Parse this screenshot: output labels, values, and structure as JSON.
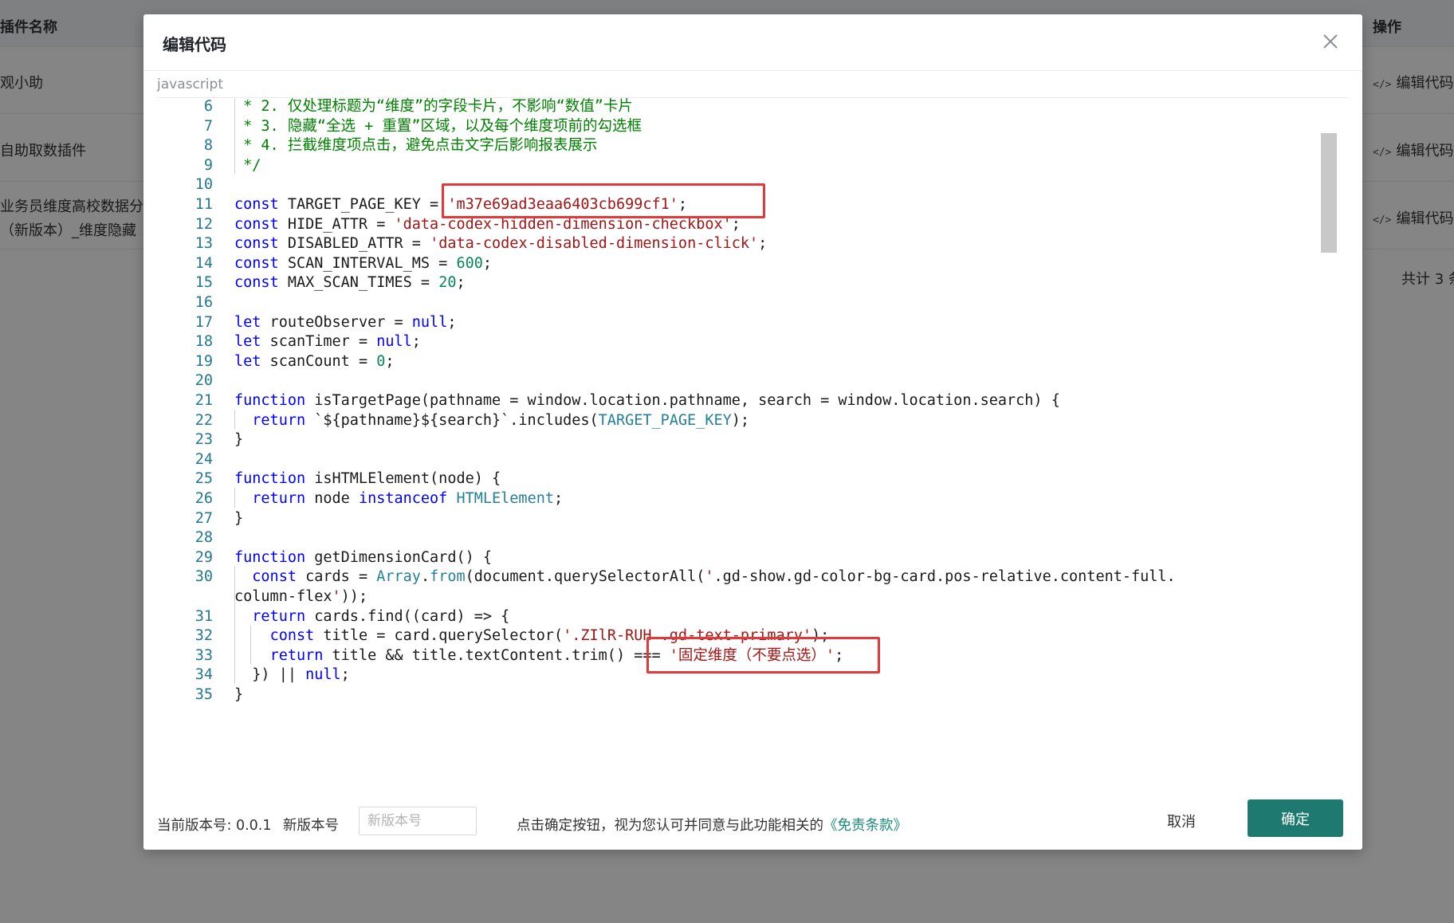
{
  "background": {
    "table_headers": {
      "name": "插件名称",
      "actions": "操作"
    },
    "rows": [
      {
        "name_line1": "观小助",
        "name_line2": "",
        "action": "编辑代码"
      },
      {
        "name_line1": "自助取数插件",
        "name_line2": "",
        "action": "编辑代码"
      },
      {
        "name_line1": "业务员维度高校数据分析",
        "name_line2": "（新版本）_维度隐藏",
        "action": "编辑代码"
      }
    ],
    "total_text": "共计 3 条",
    "action_icon_glyph": "</>"
  },
  "modal": {
    "title": "编辑代码",
    "language": "javascript",
    "close_icon": "close-icon"
  },
  "code_lines": [
    {
      "n": "6",
      "text": " * 2. 仅处理标题为“维度”的字段卡片，不影响“数值”卡片"
    },
    {
      "n": "7",
      "text": " * 3. 隐藏“全选 + 重置”区域，以及每个维度项前的勾选框"
    },
    {
      "n": "8",
      "text": " * 4. 拦截维度项点击，避免点击文字后影响报表展示"
    },
    {
      "n": "9",
      "text": " */"
    },
    {
      "n": "10",
      "text": ""
    },
    {
      "n": "11",
      "text": "const TARGET_PAGE_KEY = 'm37e69ad3eaa6403cb699cf1';"
    },
    {
      "n": "12",
      "text": "const HIDE_ATTR = 'data-codex-hidden-dimension-checkbox';"
    },
    {
      "n": "13",
      "text": "const DISABLED_ATTR = 'data-codex-disabled-dimension-click';"
    },
    {
      "n": "14",
      "text": "const SCAN_INTERVAL_MS = 600;"
    },
    {
      "n": "15",
      "text": "const MAX_SCAN_TIMES = 20;"
    },
    {
      "n": "16",
      "text": ""
    },
    {
      "n": "17",
      "text": "let routeObserver = null;"
    },
    {
      "n": "18",
      "text": "let scanTimer = null;"
    },
    {
      "n": "19",
      "text": "let scanCount = 0;"
    },
    {
      "n": "20",
      "text": ""
    },
    {
      "n": "21",
      "text": "function isTargetPage(pathname = window.location.pathname, search = window.location.search) {"
    },
    {
      "n": "22",
      "text": "  return `${pathname}${search}`.includes(TARGET_PAGE_KEY);"
    },
    {
      "n": "23",
      "text": "}"
    },
    {
      "n": "24",
      "text": ""
    },
    {
      "n": "25",
      "text": "function isHTMLElement(node) {"
    },
    {
      "n": "26",
      "text": "  return node instanceof HTMLElement;"
    },
    {
      "n": "27",
      "text": "}"
    },
    {
      "n": "28",
      "text": ""
    },
    {
      "n": "29",
      "text": "function getDimensionCard() {"
    },
    {
      "n": "30",
      "text": "  const cards = Array.from(document.querySelectorAll('.gd-show.gd-color-bg-card.pos-relative.content-full."
    },
    {
      "n": "",
      "text": "column-flex'));"
    },
    {
      "n": "31",
      "text": "  return cards.find((card) => {"
    },
    {
      "n": "32",
      "text": "    const title = card.querySelector('.ZIlR-RUH .gd-text-primary');"
    },
    {
      "n": "33",
      "text": "    return title && title.textContent.trim() === '固定维度（不要点选）';"
    },
    {
      "n": "34",
      "text": "  }) || null;"
    },
    {
      "n": "35",
      "text": "}"
    }
  ],
  "footer": {
    "current_version_label": "当前版本号: 0.0.1",
    "new_version_label": "新版本号",
    "new_version_placeholder": "新版本号",
    "new_version_value": "",
    "agreement_text": "点击确定按钮，视为您认可并同意与此功能相关的",
    "agreement_link": "《免责条款》",
    "cancel_label": "取消",
    "ok_label": "确定"
  },
  "colors": {
    "primary": "#1e7a71",
    "link": "#1a8a7a",
    "highlight_box": "#e23a3a",
    "keyword": "#0000ff",
    "string": "#a31515",
    "number": "#098658",
    "comment": "#008000",
    "line_number": "#237893"
  }
}
